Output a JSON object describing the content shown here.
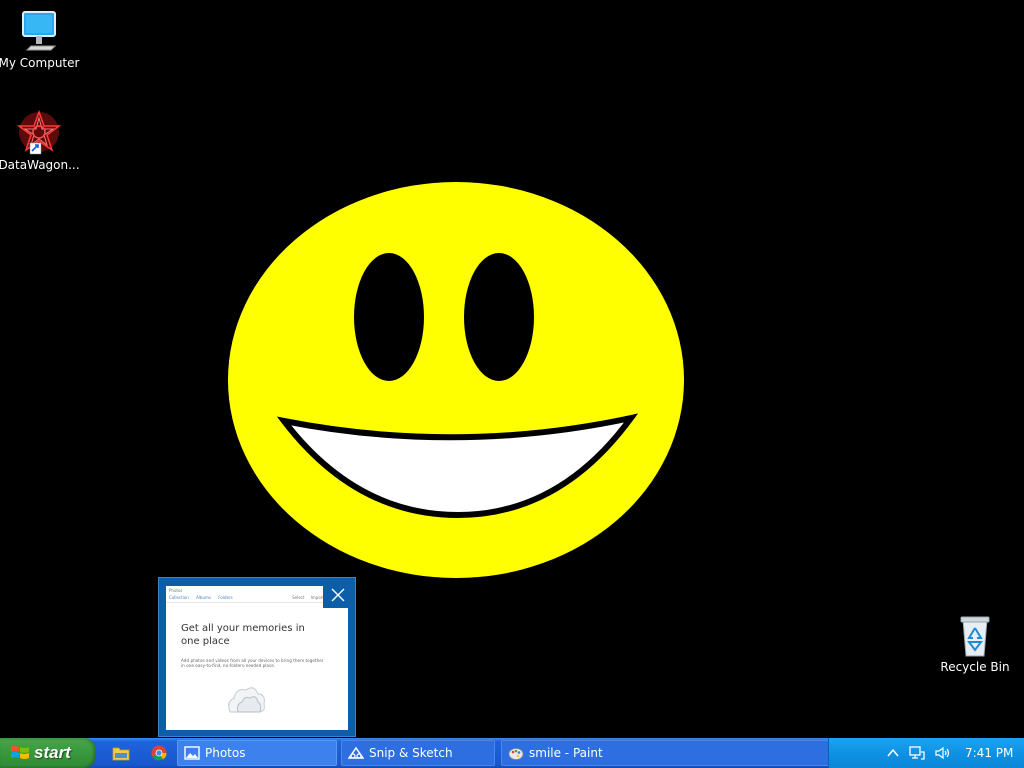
{
  "desktop": {
    "icons": [
      {
        "label": "My Computer",
        "icon": "computer-icon"
      },
      {
        "label": "DataWagon...",
        "icon": "datawagon-icon"
      },
      {
        "label": "Recycle Bin",
        "icon": "recycle-bin-icon"
      }
    ],
    "wallpaper": "smiley-face",
    "colors": {
      "background": "#000000",
      "face": "#ffff00",
      "teeth": "#ffffff"
    }
  },
  "preview": {
    "app_title": "Photos",
    "nav": "Collection Albums Folders",
    "actions": "Select Import",
    "heading": "Get all your memories in one place",
    "body": "Add photos and videos from all your devices to bring them together in one easy-to-find, no-folders-needed place."
  },
  "taskbar": {
    "start_label": "start",
    "quick_launch": [
      "file-explorer-icon",
      "chrome-icon"
    ],
    "tasks": [
      {
        "label": "Photos",
        "icon": "photos-icon",
        "active": true
      },
      {
        "label": "Snip & Sketch",
        "icon": "snip-sketch-icon",
        "active": false
      },
      {
        "label": "smile - Paint",
        "icon": "paint-icon",
        "active": false
      }
    ],
    "tray": {
      "icons": [
        "chevron-up-icon",
        "network-icon",
        "volume-icon"
      ],
      "clock": "7:41 PM"
    }
  }
}
